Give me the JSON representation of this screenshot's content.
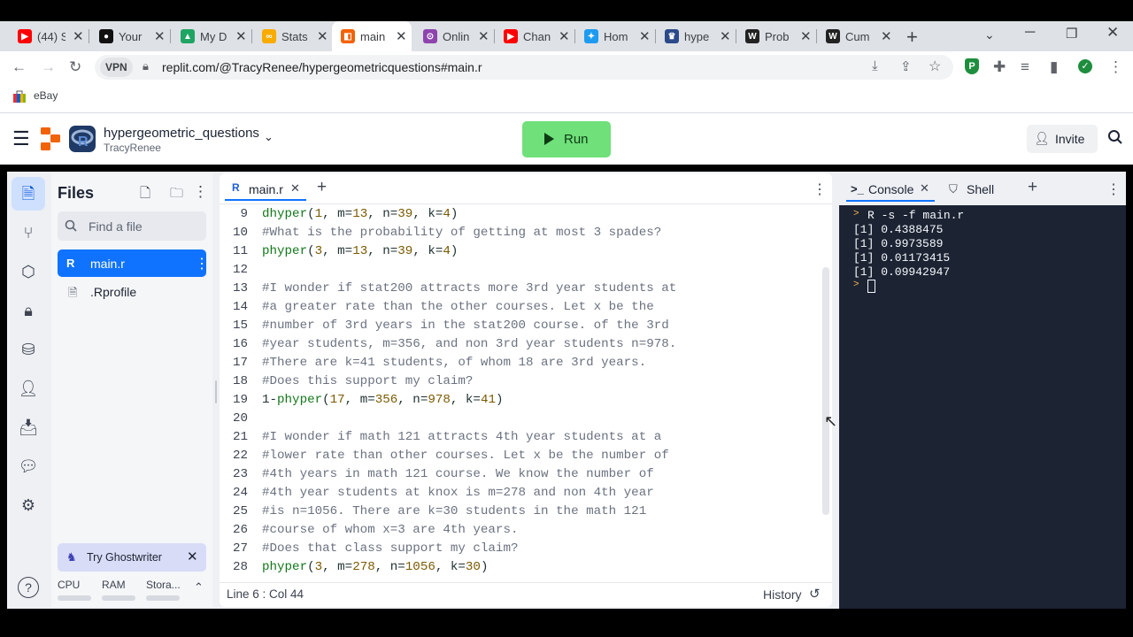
{
  "browser": {
    "tabs": [
      {
        "label": "(44) S",
        "icon": "youtube-icon",
        "color": "#ff0000",
        "glyph": "▶"
      },
      {
        "label": "Your",
        "icon": "stream-icon",
        "color": "#111111",
        "glyph": "●"
      },
      {
        "label": "My D",
        "icon": "drive-icon",
        "color": "#1fa463",
        "glyph": "▲"
      },
      {
        "label": "Stats",
        "icon": "colab-icon",
        "color": "#f9ab00",
        "glyph": "∞"
      },
      {
        "label": "main",
        "icon": "replit-icon",
        "color": "#f26207",
        "glyph": "◧"
      },
      {
        "label": "Onlin",
        "icon": "online-icon",
        "color": "#8e44ad",
        "glyph": "⊙"
      },
      {
        "label": "Chan",
        "icon": "youtube-icon",
        "color": "#ff0000",
        "glyph": "▶"
      },
      {
        "label": "Hom",
        "icon": "twitter-icon",
        "color": "#1d9bf0",
        "glyph": "✦"
      },
      {
        "label": "hype",
        "icon": "crest-icon",
        "color": "#2c4a8a",
        "glyph": "♛"
      },
      {
        "label": "Prob",
        "icon": "wikipedia-icon",
        "color": "#222222",
        "glyph": "W"
      },
      {
        "label": "Cum",
        "icon": "wikipedia-icon",
        "color": "#222222",
        "glyph": "W"
      }
    ],
    "url": "replit.com/@TracyRenee/hypergeometricquestions#main.r",
    "vpn_label": "VPN",
    "bookmark": "eBay"
  },
  "repl": {
    "title": "hypergeometric_questions",
    "owner": "TracyRenee",
    "run_label": "Run",
    "invite_label": "Invite"
  },
  "files_panel": {
    "title": "Files",
    "search_placeholder": "Find a file",
    "items": [
      "main.r",
      ".Rprofile"
    ],
    "ghostwriter": "Try Ghostwriter",
    "resources": [
      "CPU",
      "RAM",
      "Stora..."
    ]
  },
  "editor": {
    "tab": "main.r",
    "status": "Line 6 : Col 44",
    "history": "History",
    "lines": [
      {
        "n": "9",
        "t": "dhyper(1, m=13, n=39, k=4)",
        "k": "code"
      },
      {
        "n": "10",
        "t": "#What is the probability of getting at most 3 spades?",
        "k": "comment"
      },
      {
        "n": "11",
        "t": "phyper(3, m=13, n=39, k=4)",
        "k": "code"
      },
      {
        "n": "12",
        "t": "",
        "k": "code"
      },
      {
        "n": "13",
        "t": "#I wonder if stat200 attracts more 3rd year students at",
        "k": "comment"
      },
      {
        "n": "14",
        "t": "#a greater rate than the other courses. Let x be the",
        "k": "comment"
      },
      {
        "n": "15",
        "t": "#number of 3rd years in the stat200 course. of the 3rd",
        "k": "comment"
      },
      {
        "n": "16",
        "t": "#year students, m=356, and non 3rd year students n=978.",
        "k": "comment"
      },
      {
        "n": "17",
        "t": "#There are k=41 students, of whom 18 are 3rd years.",
        "k": "comment"
      },
      {
        "n": "18",
        "t": "#Does this support my claim?",
        "k": "comment"
      },
      {
        "n": "19",
        "t": "1-phyper(17, m=356, n=978, k=41)",
        "k": "code"
      },
      {
        "n": "20",
        "t": "",
        "k": "code"
      },
      {
        "n": "21",
        "t": "#I wonder if math 121 attracts 4th year students at a",
        "k": "comment"
      },
      {
        "n": "22",
        "t": "#lower rate than other courses. Let x be the number of",
        "k": "comment"
      },
      {
        "n": "23",
        "t": "#4th years in math 121 course. We know the number of",
        "k": "comment"
      },
      {
        "n": "24",
        "t": "#4th year students at knox is m=278 and non 4th year",
        "k": "comment"
      },
      {
        "n": "25",
        "t": "#is n=1056. There are k=30 students in the math 121",
        "k": "comment"
      },
      {
        "n": "26",
        "t": "#course of whom x=3 are 4th years.",
        "k": "comment"
      },
      {
        "n": "27",
        "t": "#Does that class support my claim?",
        "k": "comment"
      },
      {
        "n": "28",
        "t": "phyper(3, m=278, n=1056, k=30)",
        "k": "code"
      }
    ]
  },
  "console": {
    "tabs": [
      "Console",
      "Shell"
    ],
    "command": "R -s -f main.r",
    "output": [
      "[1] 0.4388475",
      "[1] 0.9973589",
      "[1] 0.01173415",
      "[1] 0.09942947"
    ]
  }
}
